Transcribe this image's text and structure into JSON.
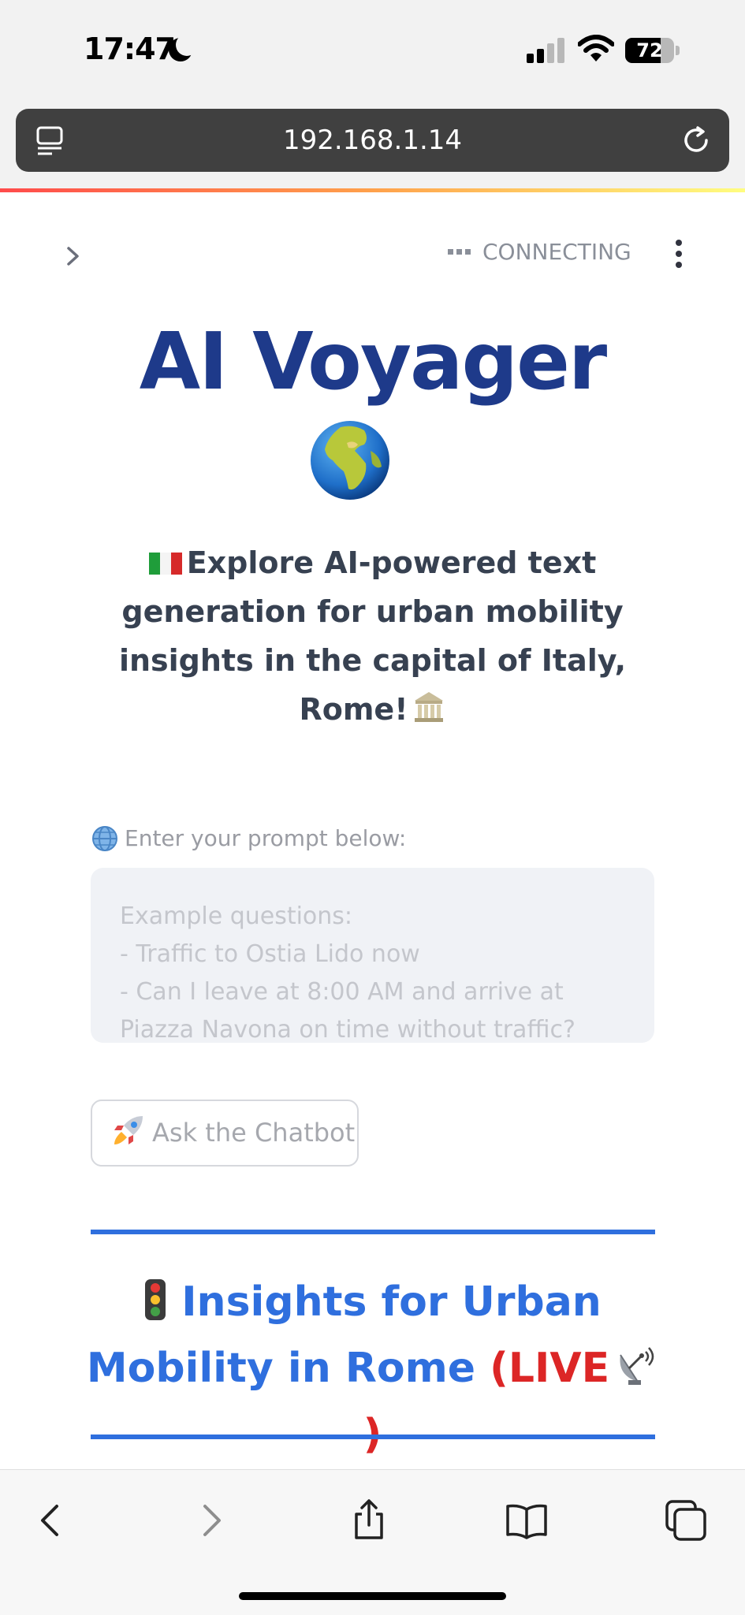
{
  "status_bar": {
    "time": "17:47",
    "battery": "72"
  },
  "browser": {
    "url": "192.168.1.14"
  },
  "app_header": {
    "status": "CONNECTING"
  },
  "hero": {
    "title": "AI Voyager",
    "subtitle": "Explore AI-powered text generation for urban mobility insights in the capital of Italy, Rome!"
  },
  "prompt": {
    "label": "Enter your prompt below:",
    "placeholder": "Example questions:\n- Traffic to Ostia Lido now\n- Can I leave at 8:00 AM and arrive at Piazza Navona on time without traffic?"
  },
  "ask_button": {
    "label": "Ask the Chatbot"
  },
  "section": {
    "title": "Insights for Urban Mobility in Rome",
    "live": "(LIVE",
    "live_close": ")"
  },
  "colors": {
    "title": "#1e3a8a",
    "section": "#2f6fde",
    "live": "#dc2626"
  },
  "icons": [
    "moon-icon",
    "tabs-icon",
    "reload-icon",
    "chevron-right-icon",
    "kebab-menu-icon",
    "globe-icon",
    "italy-flag-icon",
    "temple-icon",
    "rocket-icon",
    "traffic-light-icon",
    "satellite-dish-icon",
    "back-icon",
    "forward-icon",
    "share-icon",
    "bookmarks-icon",
    "tabs-overview-icon"
  ]
}
